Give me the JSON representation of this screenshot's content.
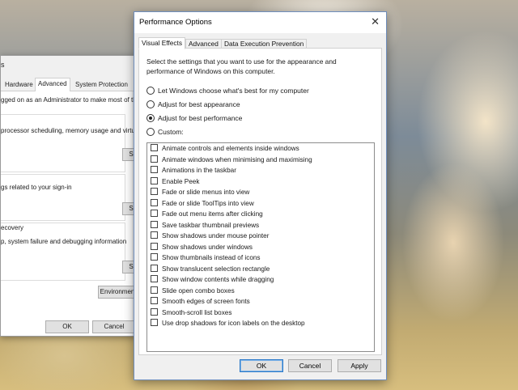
{
  "background_window": {
    "title_fragment": "s",
    "tabs": [
      {
        "label": "Hardware",
        "active": false
      },
      {
        "label": "Advanced",
        "active": true
      },
      {
        "label": "System Protection",
        "active": false
      }
    ],
    "lines": [
      "gged on as an Administrator to make most of the",
      "processor scheduling, memory usage and virtu",
      "gs related to your sign-in",
      "ecovery",
      "p, system failure and debugging information"
    ],
    "settings_buttons": [
      "S",
      "S",
      "S"
    ],
    "env_button": "Environmen",
    "ok_button": "OK",
    "cancel_button": "Cancel"
  },
  "dialog": {
    "title": "Performance Options",
    "close_glyph": "✕",
    "tabs": [
      {
        "label": "Visual Effects",
        "active": true
      },
      {
        "label": "Advanced",
        "active": false
      },
      {
        "label": "Data Execution Prevention",
        "active": false
      }
    ],
    "description": "Select the settings that you want to use for the appearance and performance of Windows on this computer.",
    "radios": [
      {
        "label": "Let Windows choose what's best for my computer",
        "selected": false
      },
      {
        "label": "Adjust for best appearance",
        "selected": false
      },
      {
        "label": "Adjust for best performance",
        "selected": true
      },
      {
        "label": "Custom:",
        "selected": false
      }
    ],
    "checkboxes": [
      {
        "label": "Animate controls and elements inside windows",
        "checked": false
      },
      {
        "label": "Animate windows when minimising and maximising",
        "checked": false
      },
      {
        "label": "Animations in the taskbar",
        "checked": false
      },
      {
        "label": "Enable Peek",
        "checked": false
      },
      {
        "label": "Fade or slide menus into view",
        "checked": false
      },
      {
        "label": "Fade or slide ToolTips into view",
        "checked": false
      },
      {
        "label": "Fade out menu items after clicking",
        "checked": false
      },
      {
        "label": "Save taskbar thumbnail previews",
        "checked": false
      },
      {
        "label": "Show shadows under mouse pointer",
        "checked": false
      },
      {
        "label": "Show shadows under windows",
        "checked": false
      },
      {
        "label": "Show thumbnails instead of icons",
        "checked": false
      },
      {
        "label": "Show translucent selection rectangle",
        "checked": false
      },
      {
        "label": "Show window contents while dragging",
        "checked": false
      },
      {
        "label": "Slide open combo boxes",
        "checked": false
      },
      {
        "label": "Smooth edges of screen fonts",
        "checked": false
      },
      {
        "label": "Smooth-scroll list boxes",
        "checked": false
      },
      {
        "label": "Use drop shadows for icon labels on the desktop",
        "checked": false
      }
    ],
    "buttons": {
      "ok": "OK",
      "cancel": "Cancel",
      "apply": "Apply"
    }
  },
  "colors": {
    "accent": "#2a78c7",
    "dialog_border": "#6f8ebd"
  }
}
